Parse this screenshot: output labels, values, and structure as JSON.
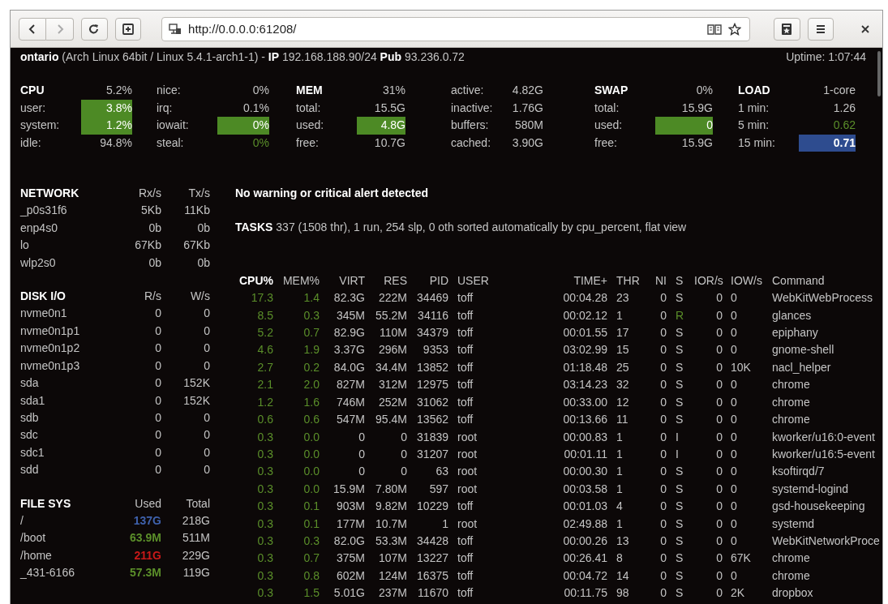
{
  "browser": {
    "url": "http://0.0.0.0:61208/",
    "back_disabled": false,
    "forward_disabled": true
  },
  "header": {
    "host_line": "**ontario** (Arch Linux 64bit / Linux 5.4.1-arch1-1) - **IP** 192.168.188.90/24 **Pub** 93.236.0.72",
    "uptime": "Uptime: 1:07:44"
  },
  "summary_columns": [
    {
      "kind": "main",
      "rows": [
        {
          "label": "CPU",
          "value": "5.2%"
        },
        {
          "label": "user:",
          "value": "3.8%",
          "color": "#4d8a25",
          "highlight": true
        },
        {
          "label": "system:",
          "value": "1.2%",
          "color": "#4d8a25",
          "highlight": true
        },
        {
          "label": "idle:",
          "value": "94.8%"
        }
      ]
    },
    {
      "kind": "extra",
      "rows": [
        {
          "label": "nice:",
          "value": "0%"
        },
        {
          "label": "irq:",
          "value": "0.1%"
        },
        {
          "label": "iowait:",
          "value": "0%",
          "color": "#4d8a25",
          "highlight": true
        },
        {
          "label": "steal:",
          "value": "0%",
          "color": "#5b8f2a",
          "highlight": false
        }
      ]
    },
    {
      "kind": "main",
      "rows": [
        {
          "label": "MEM",
          "value": "31%"
        },
        {
          "label": "total:",
          "value": "15.5G"
        },
        {
          "label": "used:",
          "value": "4.8G",
          "color": "#4d8a25",
          "highlight": true
        },
        {
          "label": "free:",
          "value": "10.7G"
        }
      ]
    },
    {
      "kind": "extra",
      "rows": [
        {
          "label": "active:",
          "value": "4.82G"
        },
        {
          "label": "inactive:",
          "value": "1.76G"
        },
        {
          "label": "buffers:",
          "value": "580M"
        },
        {
          "label": "cached:",
          "value": "3.90G"
        }
      ]
    },
    {
      "kind": "main",
      "rows": [
        {
          "label": "SWAP",
          "value": "0%"
        },
        {
          "label": "total:",
          "value": "15.9G"
        },
        {
          "label": "used:",
          "value": "0",
          "color": "#4d8a25",
          "highlight": true
        },
        {
          "label": "free:",
          "value": "15.9G"
        }
      ]
    },
    {
      "kind": "main",
      "rows": [
        {
          "label": "LOAD",
          "value": "1-core"
        },
        {
          "label": "1 min:",
          "value": "1.26"
        },
        {
          "label": "5 min:",
          "value": "0.62",
          "color": "#5b8f2a",
          "highlight": false
        },
        {
          "label": "15 min:",
          "value": "0.71",
          "color": "#2e4c8f",
          "highlight": true
        }
      ]
    }
  ],
  "sections": [
    {
      "header": [
        "NETWORK",
        "Rx/s",
        "Tx/s"
      ],
      "rows": [
        {
          "cells": [
            "_p0s31f6",
            "5Kb",
            "11Kb"
          ]
        },
        {
          "cells": [
            "enp4s0",
            "0b",
            "0b"
          ]
        },
        {
          "cells": [
            "lo",
            "67Kb",
            "67Kb"
          ]
        },
        {
          "cells": [
            "wlp2s0",
            "0b",
            "0b"
          ]
        }
      ]
    },
    {
      "header": [
        "DISK I/O",
        "R/s",
        "W/s"
      ],
      "rows": [
        {
          "cells": [
            "nvme0n1",
            "0",
            "0"
          ]
        },
        {
          "cells": [
            "nvme0n1p1",
            "0",
            "0"
          ]
        },
        {
          "cells": [
            "nvme0n1p2",
            "0",
            "0"
          ]
        },
        {
          "cells": [
            "nvme0n1p3",
            "0",
            "0"
          ]
        },
        {
          "cells": [
            "sda",
            "0",
            "152K"
          ]
        },
        {
          "cells": [
            "sda1",
            "0",
            "152K"
          ]
        },
        {
          "cells": [
            "sdb",
            "0",
            "0"
          ]
        },
        {
          "cells": [
            "sdc",
            "0",
            "0"
          ]
        },
        {
          "cells": [
            "sdc1",
            "0",
            "0"
          ]
        },
        {
          "cells": [
            "sdd",
            "0",
            "0"
          ]
        }
      ]
    },
    {
      "header": [
        "FILE SYS",
        "Used",
        "Total"
      ],
      "rows": [
        {
          "cells": [
            "/",
            "137G",
            "218G"
          ],
          "color": "#3f62ad"
        },
        {
          "cells": [
            "/boot",
            "63.9M",
            "511M"
          ],
          "color": "#5b8f2a"
        },
        {
          "cells": [
            "/home",
            "211G",
            "229G"
          ],
          "color": "#c81919"
        },
        {
          "cells": [
            "_431-6166",
            "57.3M",
            "119G"
          ],
          "color": "#5b8f2a"
        }
      ]
    }
  ],
  "alert": "No warning or critical alert detected",
  "tasks": "**TASKS** 337 (1508 thr), 1 run, 254 slp, 0 oth sorted automatically by cpu_percent, flat view",
  "process_columns": [
    {
      "label": "CPU%",
      "selected": true
    },
    {
      "label": "MEM%",
      "selected": false
    },
    {
      "label": "VIRT",
      "selected": false
    },
    {
      "label": "RES",
      "selected": false
    },
    {
      "label": "PID",
      "selected": false
    },
    {
      "label": "USER",
      "selected": false
    },
    {
      "label": "TIME+",
      "selected": false
    },
    {
      "label": "THR",
      "selected": false
    },
    {
      "label": "NI",
      "selected": false
    },
    {
      "label": "S",
      "selected": false
    },
    {
      "label": "IOR/s",
      "selected": false
    },
    {
      "label": "IOW/s",
      "selected": false
    },
    {
      "label": "Command",
      "selected": false
    }
  ],
  "processes": [
    {
      "cells": [
        "17.3",
        "1.4",
        "82.3G",
        "222M",
        "34469",
        "toff",
        "00:04.28",
        "23",
        "0",
        "S",
        "0",
        "0",
        "WebKitWebProcess"
      ],
      "running": false
    },
    {
      "cells": [
        "8.5",
        "0.3",
        "345M",
        "55.2M",
        "34116",
        "toff",
        "00:02.12",
        "1",
        "0",
        "R",
        "0",
        "0",
        "glances"
      ],
      "running": true
    },
    {
      "cells": [
        "5.2",
        "0.7",
        "82.9G",
        "110M",
        "34379",
        "toff",
        "00:01.55",
        "17",
        "0",
        "S",
        "0",
        "0",
        "epiphany"
      ],
      "running": false
    },
    {
      "cells": [
        "4.6",
        "1.9",
        "3.37G",
        "296M",
        "9353",
        "toff",
        "03:02.99",
        "15",
        "0",
        "S",
        "0",
        "0",
        "gnome-shell"
      ],
      "running": false
    },
    {
      "cells": [
        "2.7",
        "0.2",
        "84.0G",
        "34.4M",
        "13852",
        "toff",
        "01:18.48",
        "25",
        "0",
        "S",
        "0",
        "10K",
        "nacl_helper"
      ],
      "running": false
    },
    {
      "cells": [
        "2.1",
        "2.0",
        "827M",
        "312M",
        "12975",
        "toff",
        "03:14.23",
        "32",
        "0",
        "S",
        "0",
        "0",
        "chrome"
      ],
      "running": false
    },
    {
      "cells": [
        "1.2",
        "1.6",
        "746M",
        "252M",
        "31062",
        "toff",
        "00:33.00",
        "12",
        "0",
        "S",
        "0",
        "0",
        "chrome"
      ],
      "running": false
    },
    {
      "cells": [
        "0.6",
        "0.6",
        "547M",
        "95.4M",
        "13562",
        "toff",
        "00:13.66",
        "11",
        "0",
        "S",
        "0",
        "0",
        "chrome"
      ],
      "running": false
    },
    {
      "cells": [
        "0.3",
        "0.0",
        "0",
        "0",
        "31839",
        "root",
        "00:00.83",
        "1",
        "0",
        "I",
        "0",
        "0",
        "kworker/u16:0-event"
      ],
      "running": false
    },
    {
      "cells": [
        "0.3",
        "0.0",
        "0",
        "0",
        "31207",
        "root",
        "00:01.11",
        "1",
        "0",
        "I",
        "0",
        "0",
        "kworker/u16:5-event"
      ],
      "running": false
    },
    {
      "cells": [
        "0.3",
        "0.0",
        "0",
        "0",
        "63",
        "root",
        "00:00.30",
        "1",
        "0",
        "S",
        "0",
        "0",
        "ksoftirqd/7"
      ],
      "running": false
    },
    {
      "cells": [
        "0.3",
        "0.0",
        "15.9M",
        "7.80M",
        "597",
        "root",
        "00:03.58",
        "1",
        "0",
        "S",
        "0",
        "0",
        "systemd-logind"
      ],
      "running": false
    },
    {
      "cells": [
        "0.3",
        "0.1",
        "903M",
        "9.82M",
        "10229",
        "toff",
        "00:01.03",
        "4",
        "0",
        "S",
        "0",
        "0",
        "gsd-housekeeping"
      ],
      "running": false
    },
    {
      "cells": [
        "0.3",
        "0.1",
        "177M",
        "10.7M",
        "1",
        "root",
        "02:49.88",
        "1",
        "0",
        "S",
        "0",
        "0",
        "systemd"
      ],
      "running": false
    },
    {
      "cells": [
        "0.3",
        "0.3",
        "82.0G",
        "53.3M",
        "34428",
        "toff",
        "00:00.26",
        "13",
        "0",
        "S",
        "0",
        "0",
        "WebKitNetworkProce"
      ],
      "running": false
    },
    {
      "cells": [
        "0.3",
        "0.7",
        "375M",
        "107M",
        "13227",
        "toff",
        "00:26.41",
        "8",
        "0",
        "S",
        "0",
        "67K",
        "chrome"
      ],
      "running": false
    },
    {
      "cells": [
        "0.3",
        "0.8",
        "602M",
        "124M",
        "16375",
        "toff",
        "00:04.72",
        "14",
        "0",
        "S",
        "0",
        "0",
        "chrome"
      ],
      "running": false
    },
    {
      "cells": [
        "0.3",
        "1.5",
        "5.01G",
        "237M",
        "11670",
        "toff",
        "00:11.75",
        "98",
        "0",
        "S",
        "0",
        "2K",
        "dropbox"
      ],
      "running": false
    }
  ]
}
